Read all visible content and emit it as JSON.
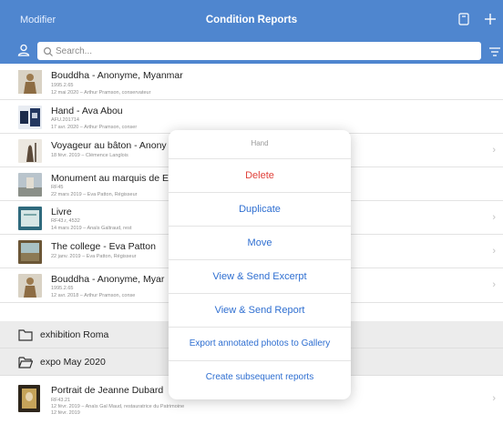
{
  "header": {
    "left_label": "Modifier",
    "title": "Condition Reports",
    "icons": [
      "note-icon",
      "plus-icon"
    ]
  },
  "search": {
    "placeholder": "Search..."
  },
  "rows": [
    {
      "name": "Bouddha - Anonyme, Myanmar",
      "sub1": "1995.2.65",
      "sub2": "12 mai 2020 – Arthur Pramson, conservateur"
    },
    {
      "name": "Hand - Ava Abou",
      "sub1": "AFU.201714",
      "sub2": "17 avr. 2020 – Arthur Pramson, conser"
    },
    {
      "name": "Voyageur au bâton - Anony",
      "sub1": "18 févr. 2019 – Clémence Langlois",
      "sub2": ""
    },
    {
      "name": "Monument au marquis de E",
      "sub1": "RF45",
      "sub2": "22 mars 2019 – Eva Patton, Régisseur"
    },
    {
      "name": "Livre",
      "sub1": "RF43.r, 4532",
      "sub2": "14 mars 2019 – Anaïs Galtraud, rest"
    },
    {
      "name": "The college - Eva Patton",
      "sub1": "22 janv. 2019 – Eva Patton, Régisseur",
      "sub2": ""
    },
    {
      "name": "Bouddha - Anonyme, Myar",
      "sub1": "1995.2.65",
      "sub2": "12 avr. 2018 – Arthur Pramson, conse"
    }
  ],
  "folders": [
    {
      "name": "exhibition Roma"
    },
    {
      "name": "expo May 2020"
    }
  ],
  "last_row": {
    "name": "Portrait de Jeanne Dubard",
    "sub1": "RF43.21",
    "sub2": "12 févr. 2019 – Anaïs Gal Maud, restauratrice du Patrimoine",
    "sub3": "12 févr. 2019"
  },
  "popover": {
    "title": "Hand",
    "actions": [
      {
        "label": "Delete",
        "style": "danger"
      },
      {
        "label": "Duplicate"
      },
      {
        "label": "Move"
      },
      {
        "label": "View & Send Excerpt"
      },
      {
        "label": "View & Send Report"
      },
      {
        "label": "Export annotated photos to Gallery"
      },
      {
        "label": "Create subsequent reports"
      }
    ]
  },
  "colors": {
    "header_bg": "#4f86cf",
    "action_blue": "#2f6fd1",
    "danger_red": "#e0413a",
    "folder_bg": "#ececec"
  }
}
